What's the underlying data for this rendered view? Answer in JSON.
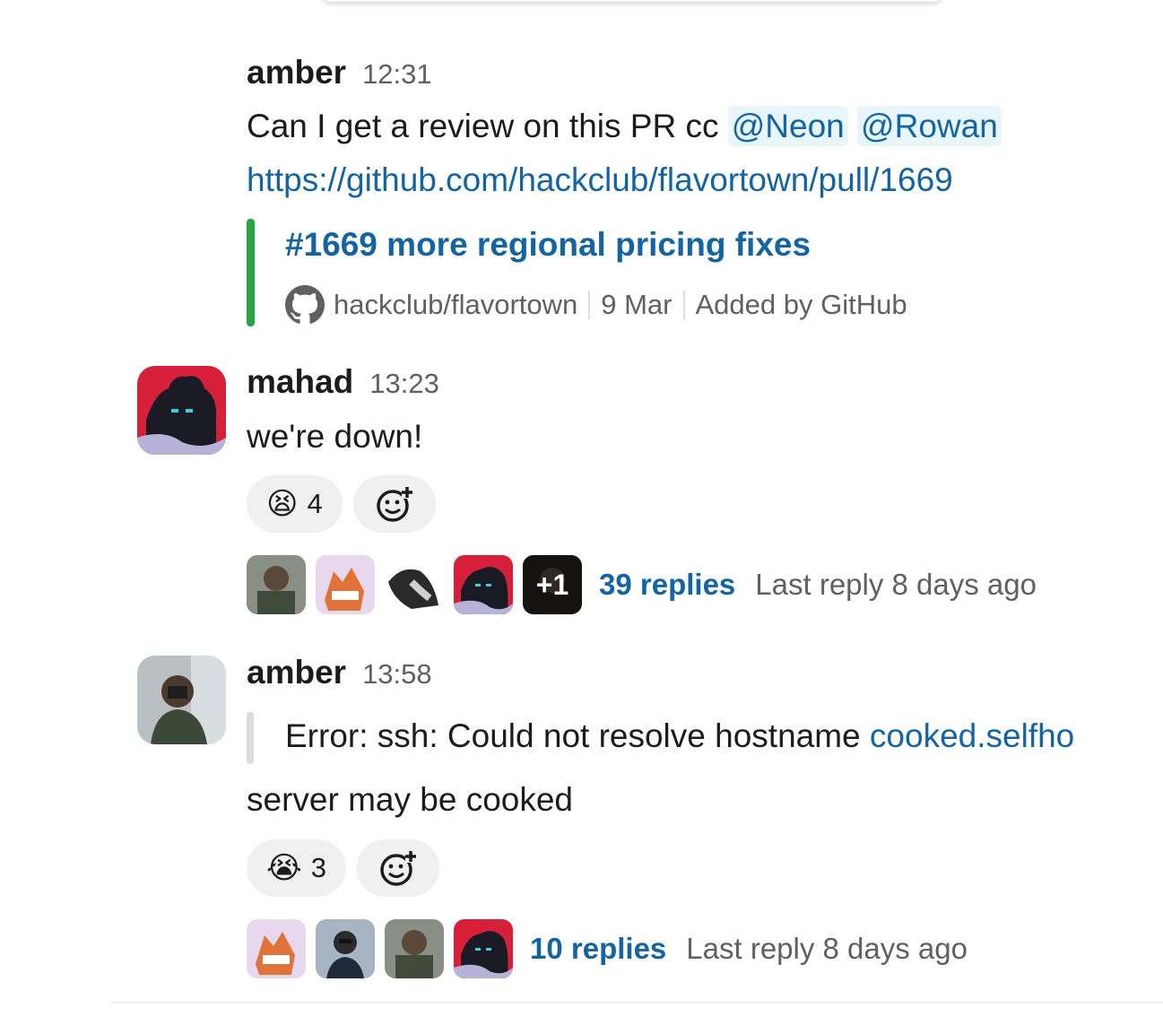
{
  "messages": [
    {
      "author": "amber",
      "time": "12:31",
      "text_prefix": "Can I get a review on this PR cc ",
      "mentions": [
        "@Neon",
        "@Rowan"
      ],
      "link": "https://github.com/hackclub/flavortown/pull/1669",
      "unfurl": {
        "title": "#1669 more regional pricing fixes",
        "repo": "hackclub/flavortown",
        "date": "9 Mar",
        "added_by": "Added by GitHub"
      }
    },
    {
      "author": "mahad",
      "time": "13:23",
      "text": "we're down!",
      "reaction": {
        "emoji": "😫",
        "count": "4"
      },
      "thread": {
        "replies": "39 replies",
        "last_reply": "Last reply 8 days ago",
        "extra": "+1"
      }
    },
    {
      "author": "amber",
      "time": "13:58",
      "quote_prefix": "Error: ssh: Could not resolve hostname ",
      "quote_link": "cooked.selfho",
      "text": "server may be cooked",
      "reaction": {
        "emoji": "😭",
        "count": "3"
      },
      "thread": {
        "replies": "10 replies",
        "last_reply": "Last reply 8 days ago"
      }
    }
  ],
  "colors": {
    "link": "#1264a3",
    "mention_bg": "#e8f5fa",
    "unfurl_bar": "#27a444",
    "muted": "#616061"
  }
}
